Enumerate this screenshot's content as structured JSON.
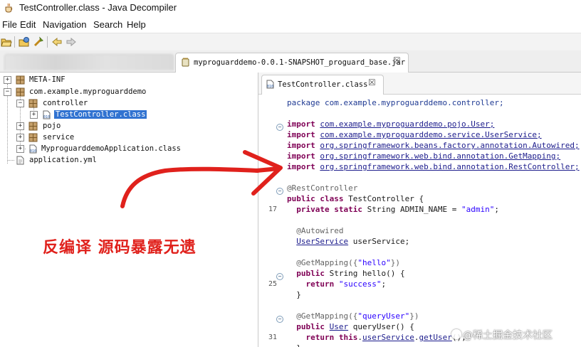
{
  "window": {
    "title": "TestController.class - Java Decompiler"
  },
  "menu": [
    "File",
    "Edit",
    "Navigation",
    "Search",
    "Help"
  ],
  "toolbar": {
    "icons": [
      "open-file-icon",
      "open-type-icon",
      "go-to-icon",
      "back-arrow-icon",
      "forward-arrow-icon"
    ]
  },
  "file_tabs": {
    "jar_tab_label": "myproguarddemo-0.0.1-SNAPSHOT_proguard_base.jar",
    "close_glyph": "☒"
  },
  "tree": {
    "items": [
      {
        "label": "META-INF"
      },
      {
        "label": "com.example.myproguarddemo"
      },
      {
        "label": "controller"
      },
      {
        "label": "TestController.class"
      },
      {
        "label": "pojo"
      },
      {
        "label": "service"
      },
      {
        "label": "MyproguarddemoApplication.class"
      },
      {
        "label": "application.yml"
      }
    ]
  },
  "editor": {
    "tab_label": "TestController.class",
    "close_glyph": "☒",
    "line_numbers": {
      "l17": "17",
      "l25": "25",
      "l31": "31"
    },
    "code": {
      "package_kw": "package",
      "package_name": " com.example.myproguarddemo.controller;",
      "import_kw": "import",
      "imports": [
        "com.example.myproguarddemo.pojo.User;",
        "com.example.myproguarddemo.service.UserService;",
        "org.springframework.beans.factory.annotation.Autowired;",
        "org.springframework.web.bind.annotation.GetMapping;",
        "org.springframework.web.bind.annotation.RestController;"
      ],
      "rest_controller": "@RestController",
      "public_kw": "public",
      "class_kw": "class",
      "class_decl": " TestController {",
      "private_static_kw": "private static",
      "admin_field": " String ADMIN_NAME = ",
      "admin_value": "\"admin\"",
      "semicolon": ";",
      "autowired": "@Autowired",
      "user_service_type": "UserService",
      "user_service_var": " userService;",
      "get_mapping_1": "@GetMapping({",
      "hello_str": "\"hello\"",
      "close_brace_paren": "})",
      "hello_decl": " String hello() {",
      "return_kw": "return",
      "success_str": "\"success\"",
      "close_brace": "}",
      "get_mapping_2": "@GetMapping({",
      "query_user_str": "\"queryUser\"",
      "user_type": "User",
      "query_user_decl": " queryUser() {",
      "this_kw": "this",
      "user_service_ref": "userService",
      "get_user": "getUser",
      "call_end": "();"
    }
  },
  "annotation": {
    "text": "反编译 源码暴露无遗",
    "color": "#e0211c"
  },
  "watermark": {
    "text": "@稀土掘金技术社区"
  }
}
